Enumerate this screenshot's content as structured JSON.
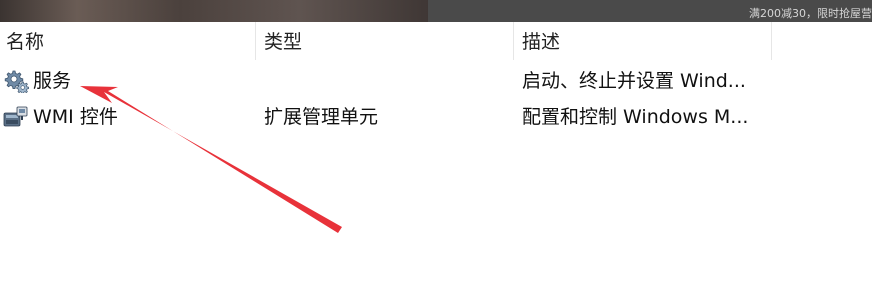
{
  "top_banner": {
    "promo_text": "满200减30，限时抢屋营"
  },
  "columns": [
    {
      "label": "名称"
    },
    {
      "label": "类型"
    },
    {
      "label": "描述"
    }
  ],
  "rows": [
    {
      "name": "服务",
      "type": "",
      "description": "启动、终止并设置 Wind...",
      "icon": "services-gear-icon"
    },
    {
      "name": "WMI 控件",
      "type": "扩展管理单元",
      "description": "配置和控制 Windows M...",
      "icon": "wmi-control-icon"
    }
  ],
  "colors": {
    "arrow": "#e8323a",
    "header_separator": "#e6e6e6"
  }
}
